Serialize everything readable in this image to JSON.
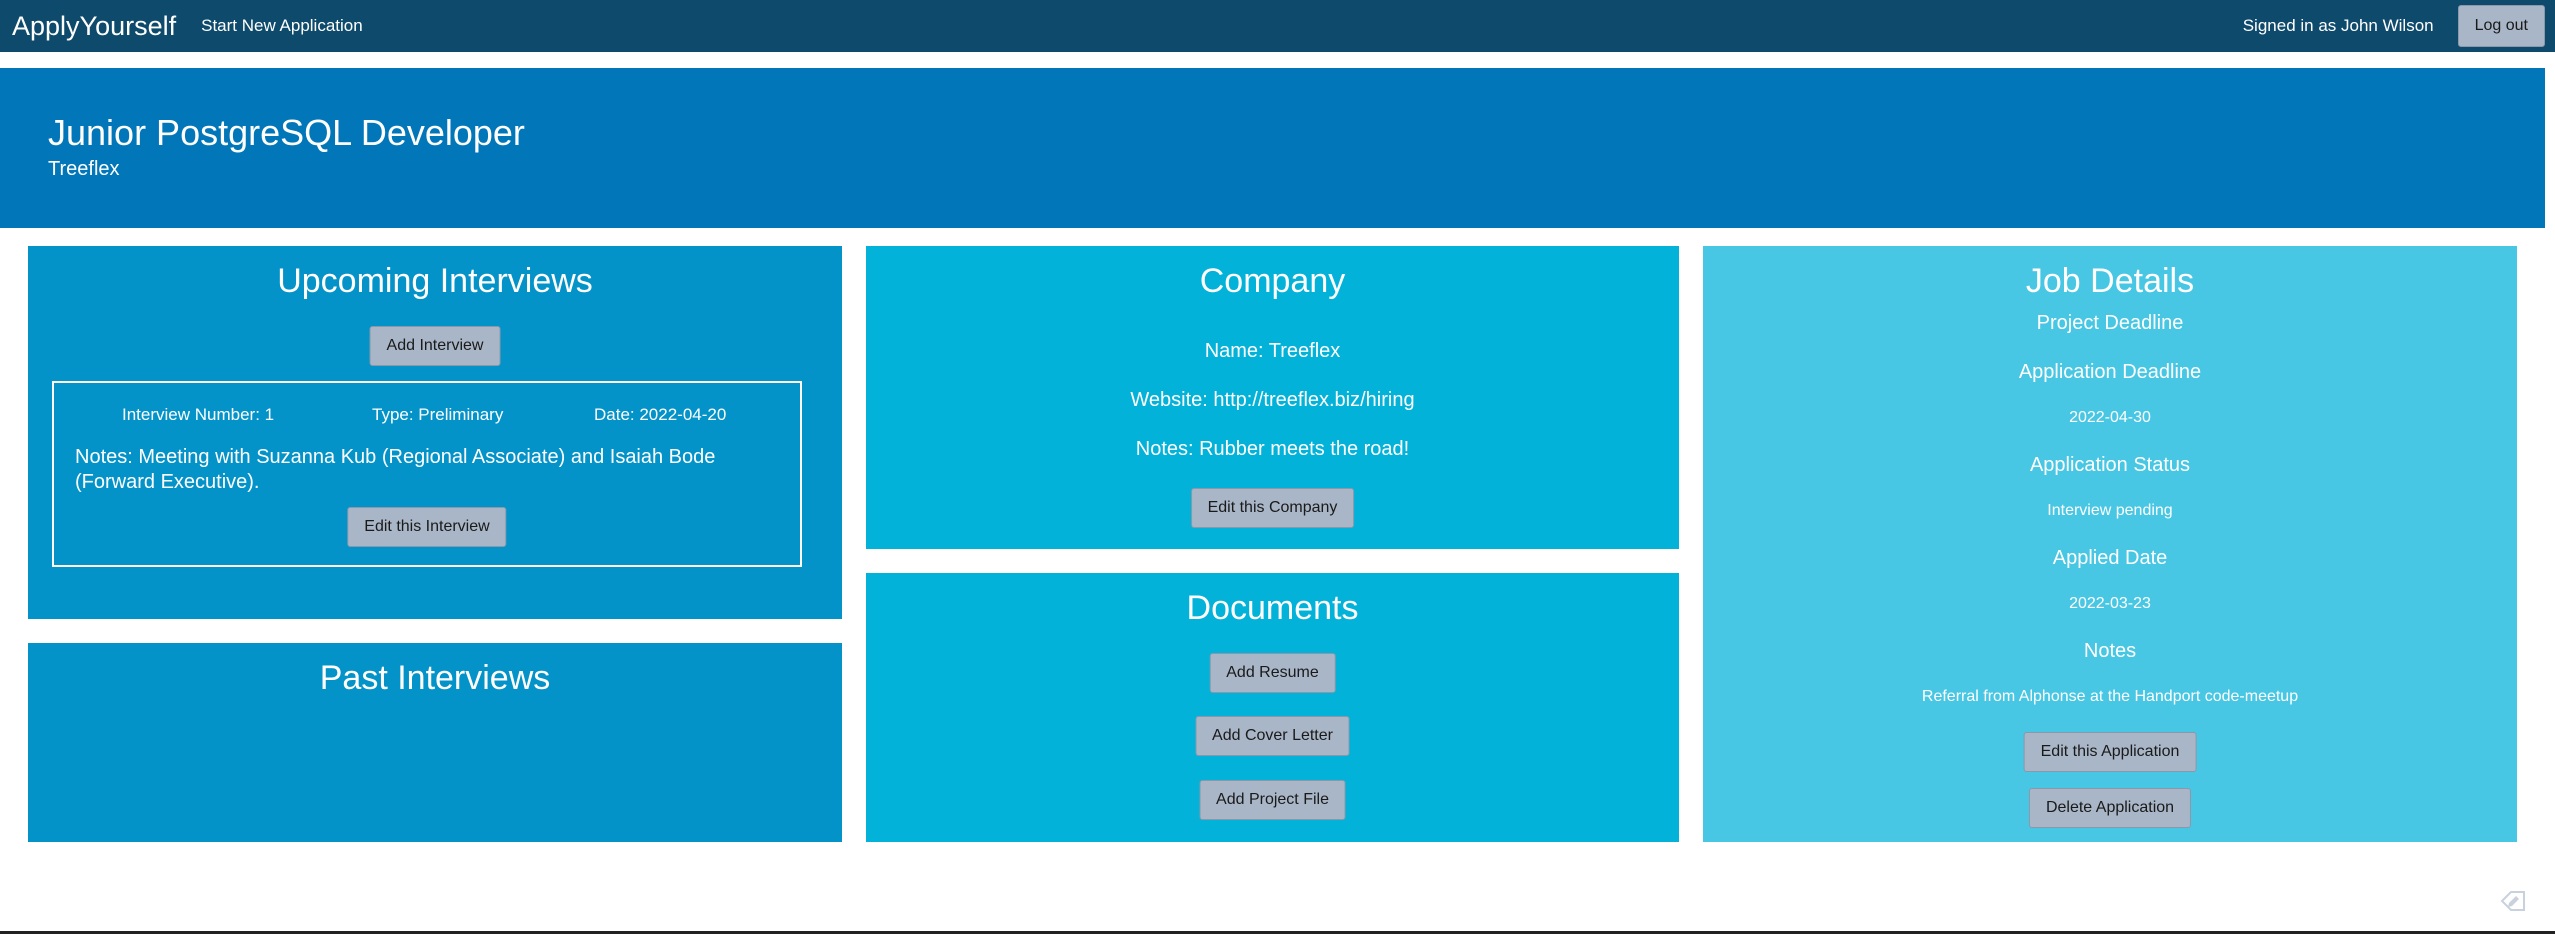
{
  "nav": {
    "brand": "ApplyYourself",
    "start_new": "Start New Application",
    "signed_in": "Signed in as John Wilson",
    "logout": "Log out"
  },
  "banner": {
    "job_title": "Junior PostgreSQL Developer",
    "company": "Treeflex"
  },
  "upcoming": {
    "title": "Upcoming Interviews",
    "add_button": "Add Interview",
    "interview": {
      "number": "Interview Number: 1",
      "type": "Type: Preliminary",
      "date": "Date: 2022-04-20",
      "notes": "Notes: Meeting with Suzanna Kub (Regional Associate) and Isaiah Bode (Forward Executive).",
      "edit_button": "Edit this Interview"
    }
  },
  "past": {
    "title": "Past Interviews"
  },
  "company": {
    "title": "Company",
    "name": "Name: Treeflex",
    "website": "Website: http://treeflex.biz/hiring",
    "notes": "Notes: Rubber meets the road!",
    "edit_button": "Edit this Company"
  },
  "documents": {
    "title": "Documents",
    "add_resume": "Add Resume",
    "add_cover_letter": "Add Cover Letter",
    "add_project_file": "Add Project File"
  },
  "job_details": {
    "title": "Job Details",
    "project_deadline_label": "Project Deadline",
    "application_deadline_label": "Application Deadline",
    "application_deadline_value": "2022-04-30",
    "status_label": "Application Status",
    "status_value": "Interview pending",
    "applied_label": "Applied Date",
    "applied_value": "2022-03-23",
    "notes_label": "Notes",
    "notes_value": "Referral from Alphonse at the Handport code-meetup",
    "edit_button": "Edit this Application",
    "delete_button": "Delete Application"
  },
  "colors": {
    "navbar": "#0e4a6c",
    "banner": "#0176b8",
    "panel_blue": "#0393c9",
    "panel_teal": "#03b2d9",
    "panel_light": "#47c7e4",
    "button": "#a9b6c7"
  },
  "icons": {
    "corner": "edit-tag-icon"
  }
}
